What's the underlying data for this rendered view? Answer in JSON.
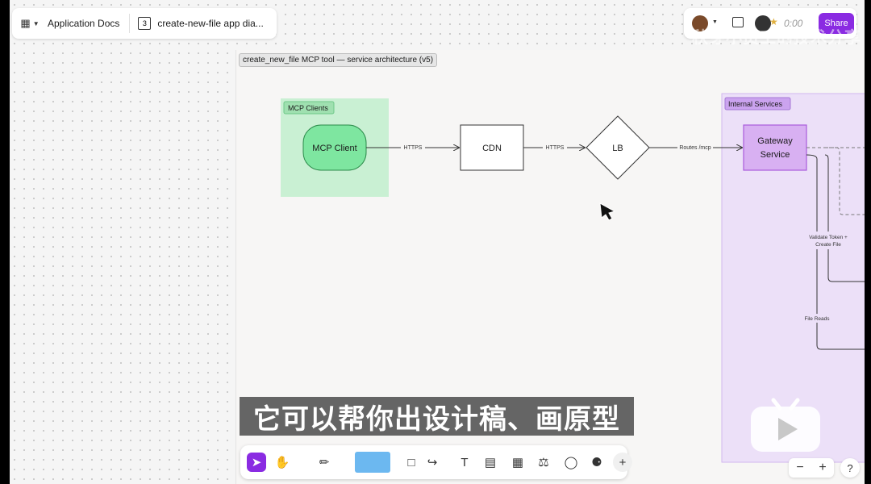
{
  "header": {
    "project_name": "Application Docs",
    "page_count": "3",
    "file_name": "create-new-file app dia...",
    "timer": "0:00",
    "share_label": "Share"
  },
  "frame": {
    "title": "create_new_file MCP tool — service architecture (v5)"
  },
  "diagram": {
    "groups": {
      "clients": "MCP Clients",
      "internal": "Internal Services"
    },
    "nodes": {
      "mcp_client": "MCP Client",
      "cdn": "CDN",
      "lb": "LB",
      "gateway_line1": "Gateway",
      "gateway_line2": "Service"
    },
    "edges": {
      "client_cdn": "HTTPS",
      "cdn_lb": "HTTPS",
      "lb_gateway": "Routes /mcp",
      "validate_line1": "Validate Token +",
      "validate_line2": "Create File",
      "file_reads": "File Reads"
    },
    "colors": {
      "client_group_fill": "#c9f0d3",
      "client_node_fill": "#7ee6a0",
      "internal_group_fill": "#e6d5f7",
      "gateway_fill": "#d8b0f2",
      "gateway_stroke": "#a95cdc",
      "accent": "#8a2be2"
    }
  },
  "toolbar": {
    "tools": [
      "move-tool",
      "hand-tool",
      "pen-tool",
      "sticky-note-tool",
      "shape-tool",
      "connector-tool",
      "text-tool",
      "section-tool",
      "table-tool",
      "stamp-tool",
      "comment-tool",
      "widgets-tool",
      "add-tool"
    ]
  },
  "zoom": {
    "minus": "−",
    "plus": "+",
    "help": "?"
  },
  "overlay": {
    "subtitle": "它可以帮你出设计稿、画原型",
    "watermark": "秋芽小员工的技术分享"
  }
}
